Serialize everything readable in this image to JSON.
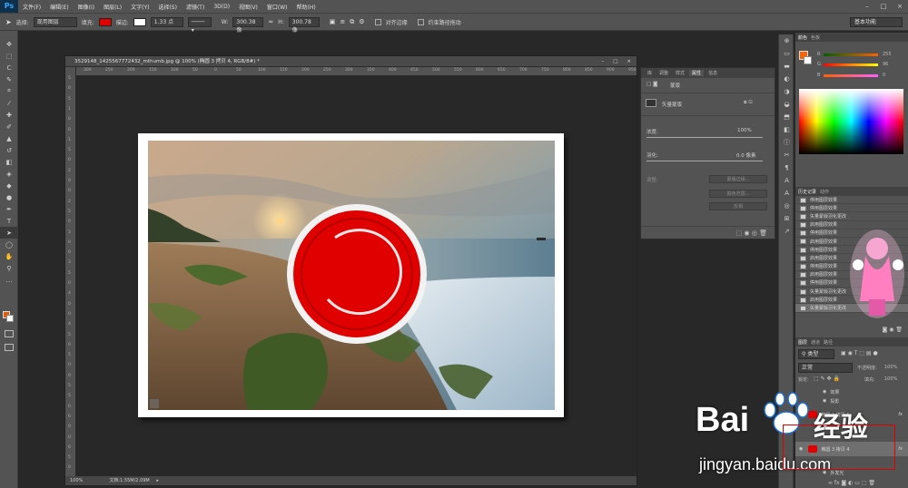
{
  "app": {
    "logo": "Ps",
    "menu": [
      "文件(F)",
      "编辑(E)",
      "图像(I)",
      "图层(L)",
      "文字(Y)",
      "选择(S)",
      "滤镜(T)",
      "3D(D)",
      "视图(V)",
      "窗口(W)",
      "帮助(H)"
    ],
    "window_controls": [
      "–",
      "□",
      "×"
    ]
  },
  "options": {
    "select_label": "选择:",
    "select_value": "现用图层",
    "fill_label": "填充:",
    "fill_color": "#e00000",
    "stroke_label": "描边:",
    "stroke_width": "1.33 点",
    "w_label": "W:",
    "w_value": "300.38 像",
    "link_icon": "link-icon",
    "h_label": "H:",
    "h_value": "300.78 像",
    "align_edges": "对齐边缘",
    "constrain_path": "约束路径拖动",
    "workspace": "基本功能"
  },
  "document": {
    "tab_title": "3529148_142556777243​2_mthumb.jpg @ 100% (椭圆 3 拷贝 4, RGB/8#) *",
    "ruler_h": [
      "300",
      "250",
      "200",
      "150",
      "100",
      "50",
      "0",
      "50",
      "100",
      "150",
      "200",
      "250",
      "300",
      "350",
      "400",
      "450",
      "500",
      "550",
      "600",
      "650",
      "700",
      "750",
      "800",
      "850",
      "900",
      "950"
    ],
    "ruler_v": [
      "5",
      "0",
      "5",
      "1",
      "0",
      "0",
      "1",
      "5",
      "0",
      "2",
      "0",
      "0",
      "2",
      "5",
      "0",
      "3",
      "0",
      "0",
      "3",
      "5",
      "0",
      "4",
      "0",
      "0",
      "4",
      "5",
      "0",
      "5",
      "0",
      "0",
      "5",
      "5",
      "0",
      "6",
      "0",
      "0",
      "6",
      "5",
      "0"
    ],
    "zoom": "100%",
    "doc_size": "文档:1.55M/2.09M",
    "arrow": "▸"
  },
  "properties": {
    "tabs": [
      "库",
      "调整",
      "样式",
      "属性",
      "信息"
    ],
    "active_tab": "属性",
    "mask_label": "蒙版",
    "vector_mask_label": "矢量蒙版",
    "density_label": "浓度:",
    "density_value": "100%",
    "feather_label": "羽化:",
    "feather_value": "0.0 像素",
    "adjust_label": "调整:",
    "btn_select_mask": "蒙版边缘...",
    "btn_color_range": "颜色范围...",
    "btn_invert": "反相"
  },
  "color_panel": {
    "tabs": [
      "颜色",
      "色板"
    ],
    "r_label": "R",
    "r_value": "255",
    "g_label": "G",
    "g_value": "96",
    "b_label": "B",
    "b_value": "0",
    "fg_color": "#ff6000"
  },
  "history": {
    "tabs": [
      "历史记录",
      "动作"
    ],
    "items": [
      "停用图层效果",
      "停用图层效果",
      "矢量蒙版羽化更改",
      "启用图层效果",
      "停用图层效果",
      "启用图层效果",
      "停用图层效果",
      "启用图层效果",
      "停用图层效果",
      "启用图层效果",
      "停用图层效果",
      "矢量蒙版羽化更改",
      "启用图层效果",
      "矢量蒙版羽化更改"
    ]
  },
  "layers": {
    "tabs": [
      "图层",
      "通道",
      "路径"
    ],
    "filter_kind": "类型",
    "blend_mode": "正常",
    "opacity_label": "不透明度:",
    "opacity_value": "100%",
    "lock_label": "锁定:",
    "fill_label": "填充:",
    "fill_value": "100%",
    "rows": [
      {
        "name": "效果"
      },
      {
        "name": "投影"
      },
      {
        "name": "椭圆 1 拷贝 5"
      },
      {
        "name": "椭圆 3 拷贝 4"
      },
      {
        "name": "外发光"
      }
    ],
    "fx": "fx"
  },
  "watermark": {
    "brand": "Bai",
    "brand2": "经验",
    "url": "jingyan.baidu.com"
  }
}
